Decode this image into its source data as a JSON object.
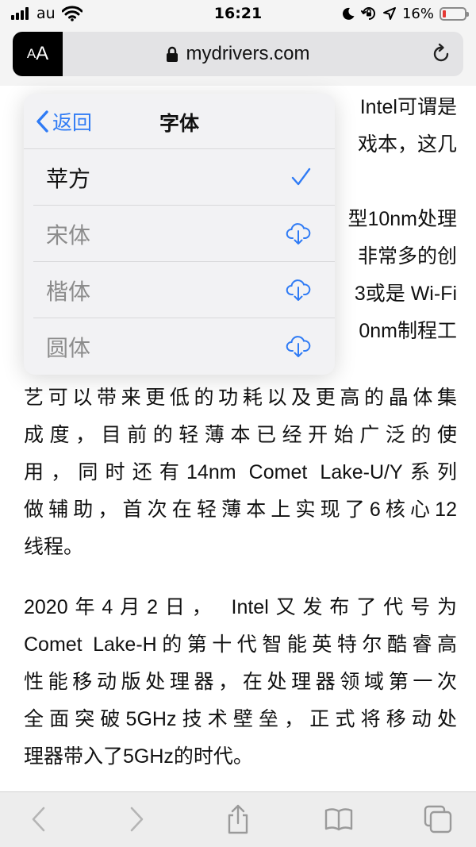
{
  "status_bar": {
    "carrier": "au",
    "time": "16:21",
    "battery_percent": "16%",
    "battery_level": 0.16,
    "icons": [
      "signal-icon",
      "wifi-icon",
      "moon-icon",
      "orientation-lock-icon",
      "location-icon",
      "battery-icon"
    ]
  },
  "address_bar": {
    "text_size_button": {
      "small": "A",
      "large": "A"
    },
    "url": "mydrivers.com",
    "icons": [
      "lock-icon",
      "reload-icon"
    ]
  },
  "font_popover": {
    "back_label": "返回",
    "title": "字体",
    "fonts": [
      {
        "name": "苹方",
        "state": "selected",
        "icon": "checkmark-icon"
      },
      {
        "name": "宋体",
        "state": "download",
        "icon": "cloud-download-icon"
      },
      {
        "name": "楷体",
        "state": "download",
        "icon": "cloud-download-icon"
      },
      {
        "name": "圆体",
        "state": "download",
        "icon": "cloud-download-icon"
      }
    ],
    "accent_color": "#2f7bf5"
  },
  "article": {
    "partial_lines": [
      "Intel可谓是",
      "戏本，这几",
      "型10nm处理",
      "非常多的创",
      "3或是 Wi-Fi",
      "0nm制程工"
    ],
    "paragraph1_lines": [
      "艺可以带来更低的功耗以及更高的晶体集",
      "成度，目前的轻薄本已经开始广泛的使",
      "用，同时还有14nm Comet Lake-U/Y系列",
      "做辅助，首次在轻薄本上实现了6核心12",
      "线程。"
    ],
    "paragraph2_lines": [
      "2020年4月2日， Intel又发布了代号为",
      "Comet Lake-H的第十代智能英特尔酷睿高",
      "性能移动版处理器，在处理器领域第一次",
      "全面突破5GHz技术壁垒，正式将移动处",
      "理器带入了5GHz的时代。"
    ]
  },
  "toolbar": {
    "buttons": [
      "back-icon",
      "forward-icon",
      "share-icon",
      "bookmarks-icon",
      "tabs-icon"
    ]
  }
}
